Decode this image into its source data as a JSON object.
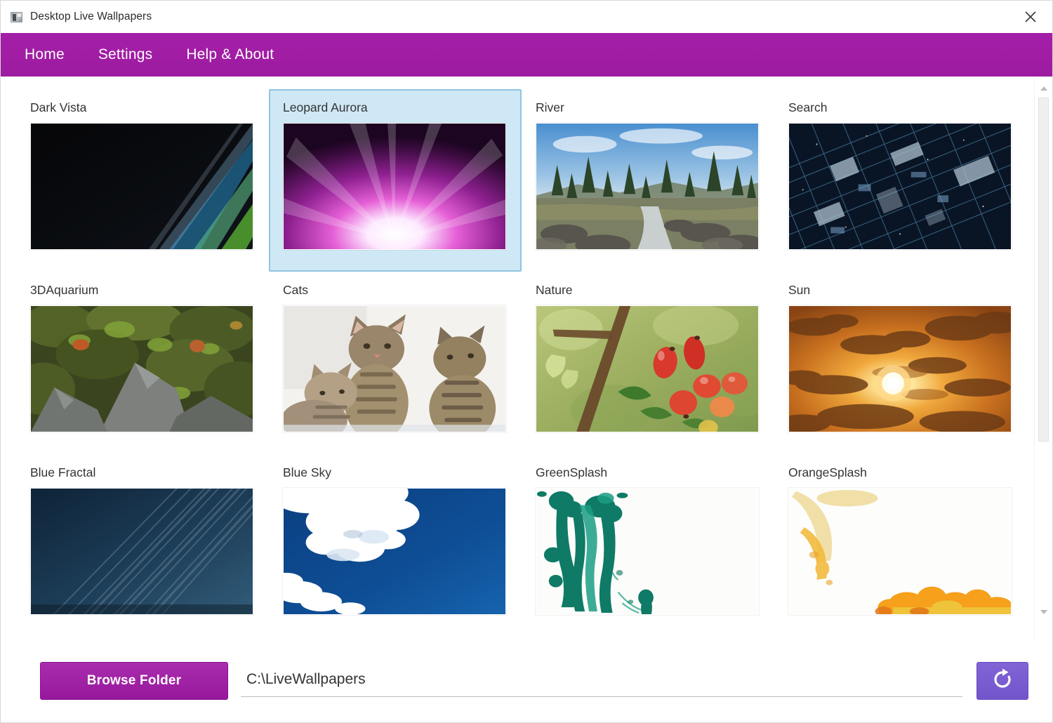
{
  "window": {
    "title": "Desktop Live Wallpapers",
    "app_icon": "app-window-icon",
    "close_icon": "close-icon"
  },
  "menu": {
    "accent_color": "#a21fa6",
    "items": [
      {
        "label": "Home",
        "name": "menu-item-home"
      },
      {
        "label": "Settings",
        "name": "menu-item-settings"
      },
      {
        "label": "Help & About",
        "name": "menu-item-help-about"
      }
    ]
  },
  "gallery": {
    "selected": "Leopard Aurora",
    "selection_color": "#cfe8f5",
    "items": [
      {
        "label": "Dark Vista",
        "thumb": "dark-vista"
      },
      {
        "label": "Leopard Aurora",
        "thumb": "leopard-aurora",
        "selected": true
      },
      {
        "label": "River",
        "thumb": "river"
      },
      {
        "label": "Search",
        "thumb": "search"
      },
      {
        "label": "3DAquarium",
        "thumb": "3daquarium"
      },
      {
        "label": "Cats",
        "thumb": "cats"
      },
      {
        "label": "Nature",
        "thumb": "nature"
      },
      {
        "label": "Sun",
        "thumb": "sun"
      },
      {
        "label": "Blue Fractal",
        "thumb": "blue-fractal"
      },
      {
        "label": "Blue Sky",
        "thumb": "blue-sky"
      },
      {
        "label": "GreenSplash",
        "thumb": "green-splash"
      },
      {
        "label": "OrangeSplash",
        "thumb": "orange-splash"
      }
    ]
  },
  "scrollbar": {
    "up_icon": "chevron-up-icon",
    "down_icon": "chevron-down-icon",
    "thumb": "scroll-thumb"
  },
  "footer": {
    "browse_label": "Browse Folder",
    "browse_color": "#a82cae",
    "path_value": "C:\\LiveWallpapers",
    "path_placeholder": "C:\\LiveWallpapers",
    "refresh_icon": "refresh-icon",
    "refresh_color": "#7b5ed0"
  }
}
